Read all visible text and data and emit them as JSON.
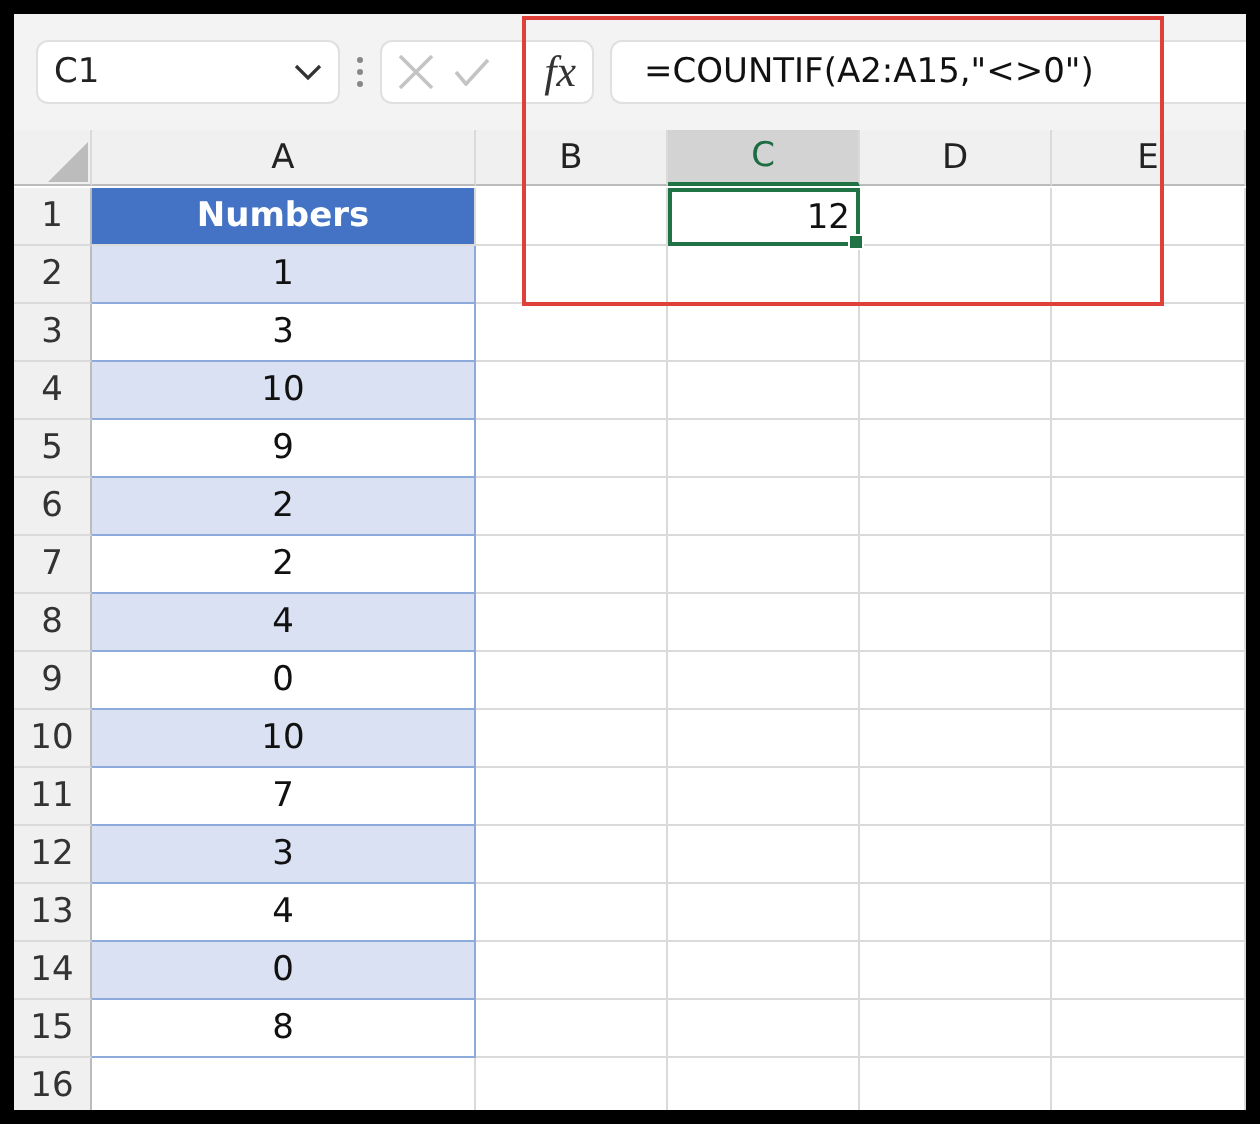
{
  "name_box": {
    "value": "C1"
  },
  "formula_bar": {
    "fx": "fx",
    "formula": "=COUNTIF(A2:A15,\"<>0\")"
  },
  "columns": [
    {
      "label": "A",
      "selected": false
    },
    {
      "label": "B",
      "selected": false
    },
    {
      "label": "C",
      "selected": true
    },
    {
      "label": "D",
      "selected": false
    },
    {
      "label": "E",
      "selected": false
    }
  ],
  "rows": [
    {
      "label": "1",
      "a": {
        "text": "Numbers",
        "kind": "header"
      },
      "c": {
        "text": "12",
        "selected": true
      }
    },
    {
      "label": "2",
      "a": {
        "text": "1",
        "kind": "shaded"
      }
    },
    {
      "label": "3",
      "a": {
        "text": "3",
        "kind": "plain"
      }
    },
    {
      "label": "4",
      "a": {
        "text": "10",
        "kind": "shaded"
      }
    },
    {
      "label": "5",
      "a": {
        "text": "9",
        "kind": "plain"
      }
    },
    {
      "label": "6",
      "a": {
        "text": "2",
        "kind": "shaded"
      }
    },
    {
      "label": "7",
      "a": {
        "text": "2",
        "kind": "plain"
      }
    },
    {
      "label": "8",
      "a": {
        "text": "4",
        "kind": "shaded"
      }
    },
    {
      "label": "9",
      "a": {
        "text": "0",
        "kind": "plain"
      }
    },
    {
      "label": "10",
      "a": {
        "text": "10",
        "kind": "shaded"
      }
    },
    {
      "label": "11",
      "a": {
        "text": "7",
        "kind": "plain"
      }
    },
    {
      "label": "12",
      "a": {
        "text": "3",
        "kind": "shaded"
      }
    },
    {
      "label": "13",
      "a": {
        "text": "4",
        "kind": "plain"
      }
    },
    {
      "label": "14",
      "a": {
        "text": "0",
        "kind": "shaded"
      }
    },
    {
      "label": "15",
      "a": {
        "text": "8",
        "kind": "plain"
      }
    },
    {
      "label": "16"
    }
  ]
}
